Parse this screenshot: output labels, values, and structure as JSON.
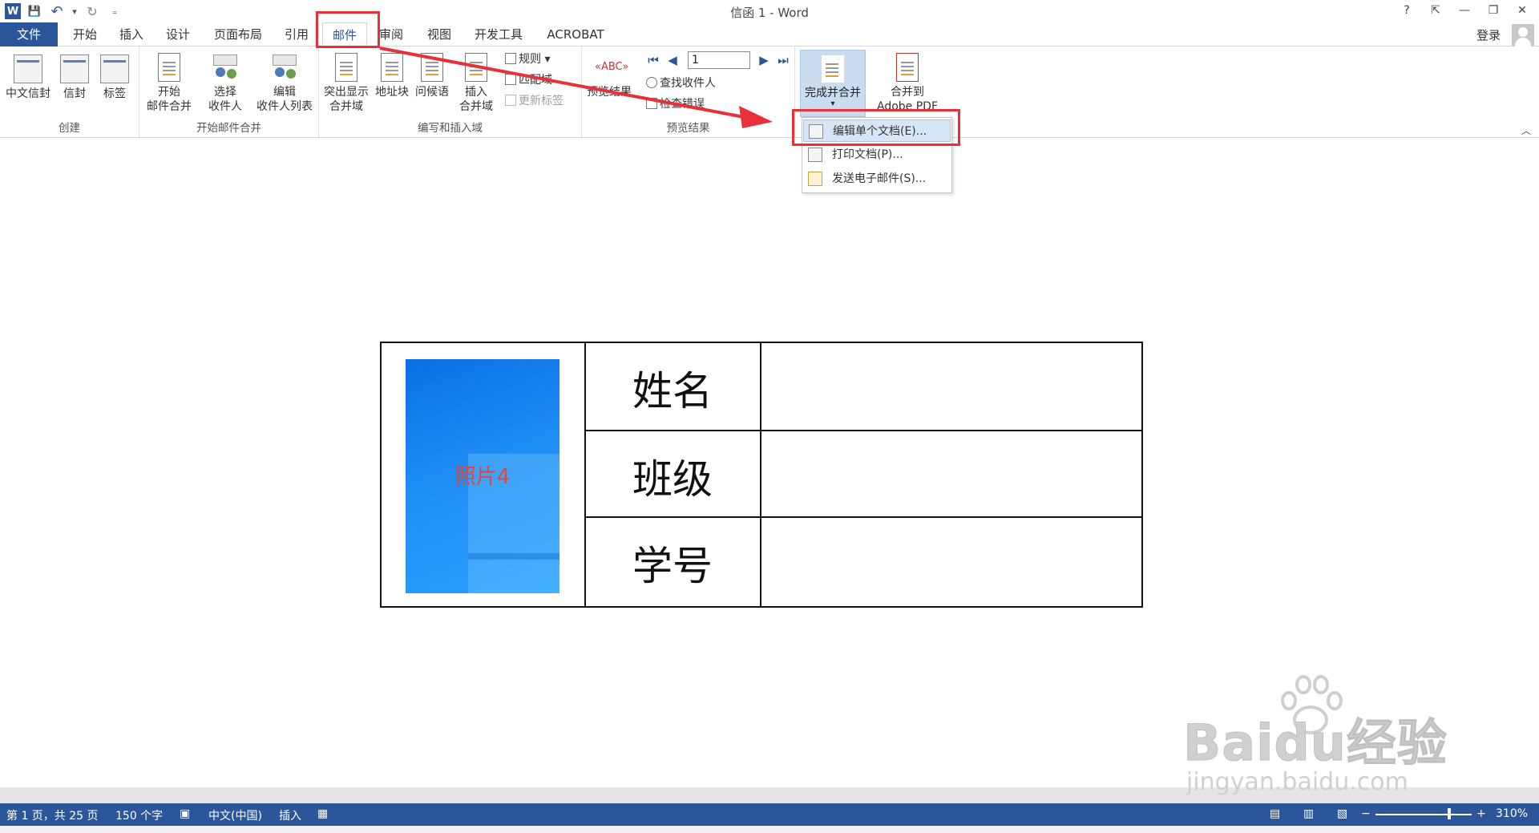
{
  "window": {
    "title": "信函 1 - Word",
    "help": "?",
    "ribbon_display": "⇱",
    "minimize": "—",
    "restore": "❐",
    "close": "✕"
  },
  "qat": {
    "word_logo": "W",
    "save": "💾",
    "undo": "↶",
    "undo_dropdown": "▾",
    "redo": "↻",
    "customize": "₌"
  },
  "tabs": [
    {
      "label": "文件"
    },
    {
      "label": "开始"
    },
    {
      "label": "插入"
    },
    {
      "label": "设计"
    },
    {
      "label": "页面布局"
    },
    {
      "label": "引用"
    },
    {
      "label": "邮件"
    },
    {
      "label": "审阅"
    },
    {
      "label": "视图"
    },
    {
      "label": "开发工具"
    },
    {
      "label": "ACROBAT"
    }
  ],
  "account": {
    "login": "登录"
  },
  "ribbon": {
    "create": {
      "label": "创建",
      "chinese_envelope": "中文信封",
      "envelope": "信封",
      "labels": "标签"
    },
    "start_merge": {
      "label": "开始邮件合并",
      "start_line1": "开始",
      "start_line2": "邮件合并",
      "select_line1": "选择",
      "select_line2": "收件人",
      "edit_line1": "编辑",
      "edit_line2": "收件人列表"
    },
    "write_insert": {
      "label": "编写和插入域",
      "highlight_line1": "突出显示",
      "highlight_line2": "合并域",
      "address_block": "地址块",
      "greeting": "问候语",
      "insert_line1": "插入",
      "insert_line2": "合并域",
      "rules": "规则",
      "match_fields": "匹配域",
      "update_labels": "更新标签"
    },
    "preview": {
      "label": "预览结果",
      "preview_results": "预览结果",
      "record": "1",
      "find_recipient": "查找收件人",
      "check_errors": "检查错误",
      "first": "⏮",
      "prev": "◀",
      "next": "▶",
      "last": "⏭"
    },
    "finish": {
      "finish_merge": "完成并合并",
      "merge_pdf_line1": "合并到",
      "merge_pdf_line2": "Adobe PDF",
      "collapse": "︿"
    }
  },
  "finish_menu": [
    {
      "label": "编辑单个文档(E)..."
    },
    {
      "label": "打印文档(P)..."
    },
    {
      "label": "发送电子邮件(S)..."
    }
  ],
  "document": {
    "photo_label": "照片4",
    "rows": [
      {
        "label": "姓名",
        "value": ""
      },
      {
        "label": "班级",
        "value": ""
      },
      {
        "label": "学号",
        "value": ""
      }
    ]
  },
  "statusbar": {
    "page": "第 1 页，共 25 页",
    "words": "150 个字",
    "language": "中文(中国)",
    "mode": "插入",
    "zoom_minus": "−",
    "zoom_plus": "+",
    "zoom": "310%"
  },
  "watermark": {
    "main": "Baidu经验",
    "sub": "jingyan.baidu.com"
  },
  "colors": {
    "accent": "#2b579a",
    "annotation": "#e8303a",
    "menu_highlight": "#d7e6f6"
  }
}
